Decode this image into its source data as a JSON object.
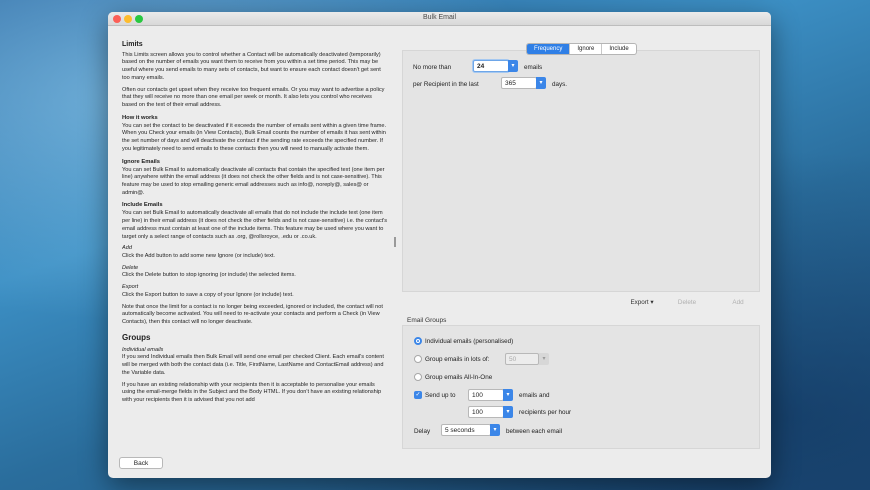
{
  "window": {
    "title": "Bulk Email"
  },
  "help": {
    "limits_title": "Limits",
    "limits_p1": "This Limits screen allows you to control whether a Contact will be automatically deactivated (temporarily) based on the number of emails you want them to receive from you within a set time period. This may be useful where you send emails to many sets of contacts, but want to ensure each contact doesn't get sent too many emails.",
    "limits_p2": "Often our contacts get upset when they receive too frequent emails. Or you may want to advertise a policy that they will receive no more than one email per week or month. It also lets you control who receives based on the text of their email address.",
    "how_title": "How it works",
    "how_p": "You can set the contact to be deactivated if it exceeds the number of emails sent within a given time frame. When you Check your emails (in View Contacts), Bulk Email counts the number of emails it has sent within the set number of days and will deactivate the contact if the sending rate exceeds the specified number. If you legitimately need to send emails to these contacts then you will need to manually activate them.",
    "ignore_title": "Ignore Emails",
    "ignore_p": "You can set Bulk Email to automatically deactivate all contacts that contain the specified text (one item per line) anywhere within the email address (it does not check the other fields and is not case-sensitive). This feature may be used to stop emailing generic email addresses such as info@, noreply@, sales@ or admin@.",
    "include_title": "Include Emails",
    "include_p": "You can set Bulk Email to automatically deactivate all emails that do not include the include text (one item per line) in their email address (it does not check the other fields and is not case-sensitive) i.e. the contact's email address must contain at least one of the include items. This feature may be used where you want to target only a select range of contacts such as .org, @rollsroyce, .edu or .co.uk.",
    "add_title": "Add",
    "add_p": "Click the Add button to add some new Ignore (or include) text.",
    "delete_title": "Delete",
    "delete_p": "Click the Delete button to stop ignoring (or include) the selected items.",
    "export_title": "Export",
    "export_p": "Click the Export button to save a copy of your Ignore (or include) text.",
    "note_p": "Note that once the limit for a contact is no longer being exceeded, ignored or included, the contact will not automatically become activated. You will need to re-activate your contacts and perform a Check (in View Contacts), then this contact will no longer deactivate.",
    "groups_title": "Groups",
    "individual_title": "Individual emails",
    "individual_p1": "If you send Individual emails then Bulk Email will send one email per checked Client. Each email's content will be merged with both the contact data (i.e. Title, FirstName, LastName and ContactEmail address) and the Variable data.",
    "individual_p2": "If you have an existing relationship with your recipients then it is acceptable to personalise your emails using the email-merge fields in the Subject and the Body HTML. If you don't have an existing relationship with your recipients then it is advised that you not add"
  },
  "footer": {
    "back_label": "Back"
  },
  "limits": {
    "tabs": [
      "Frequency",
      "Ignore",
      "Include"
    ],
    "no_more_than_label": "No more than",
    "no_more_than_value": "24",
    "emails_label": "emails",
    "per_recipient_label": "per Recipient in the last",
    "days_value": "365",
    "days_label": "days.",
    "export_label": "Export",
    "delete_label": "Delete",
    "add_label": "Add"
  },
  "email_groups": {
    "title": "Email Groups",
    "individual_label": "Individual emails (personalised)",
    "lots_label": "Group emails in lots of:",
    "lots_value": "50",
    "all_in_one_label": "Group emails All-In-One",
    "send_up_to_label": "Send up to",
    "send_up_to_value": "100",
    "emails_and_label": "emails and",
    "recipients_value": "100",
    "recipients_label": "recipients per hour",
    "delay_label": "Delay",
    "delay_value": "5 seconds",
    "between_label": "between each email"
  },
  "colors": {
    "accent": "#2f7fe6",
    "window_bg": "#ececec"
  }
}
